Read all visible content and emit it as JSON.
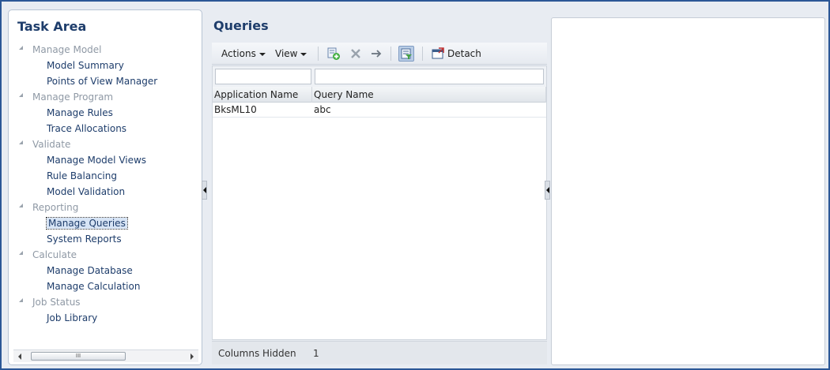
{
  "task_area": {
    "title": "Task Area",
    "groups": [
      {
        "label": "Manage Model",
        "items": [
          "Model Summary",
          "Points of View Manager"
        ]
      },
      {
        "label": "Manage Program",
        "items": [
          "Manage Rules",
          "Trace Allocations"
        ]
      },
      {
        "label": "Validate",
        "items": [
          "Manage Model Views",
          "Rule Balancing",
          "Model Validation"
        ]
      },
      {
        "label": "Reporting",
        "items": [
          "Manage Queries",
          "System Reports"
        ]
      },
      {
        "label": "Calculate",
        "items": [
          "Manage Database",
          "Manage Calculation"
        ]
      },
      {
        "label": "Job Status",
        "items": [
          "Job Library"
        ]
      }
    ],
    "selected_item": "Manage Queries",
    "scroll_thumb_label": "III"
  },
  "queries": {
    "title": "Queries",
    "toolbar": {
      "actions_label": "Actions",
      "view_label": "View",
      "detach_label": "Detach",
      "icons": [
        "add-query-icon",
        "delete-icon",
        "arrow-right-icon",
        "query-by-example-icon",
        "detach-icon"
      ]
    },
    "columns": [
      "Application Name",
      "Query Name"
    ],
    "rows": [
      [
        "BksML10",
        "abc"
      ]
    ],
    "filter_values": [
      "",
      ""
    ],
    "status": {
      "label": "Columns Hidden",
      "value": "1"
    }
  },
  "colors": {
    "frame": "#2b5796",
    "title_text": "#1e3d6b",
    "panel_bg": "#e8ecf2"
  }
}
